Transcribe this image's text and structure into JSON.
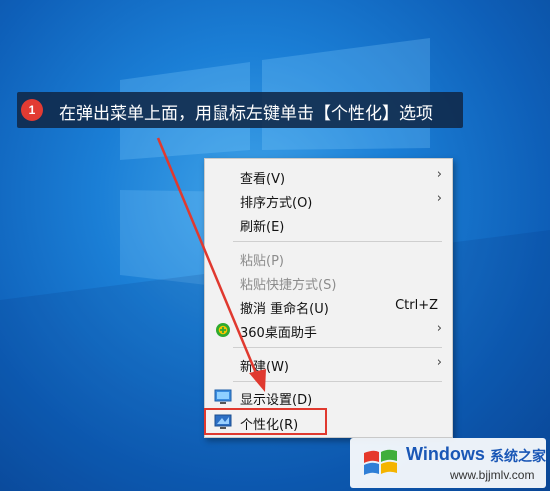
{
  "callout": {
    "step": "1",
    "text": "在弹出菜单上面，用鼠标左键单击【个性化】选项"
  },
  "menu": {
    "items": [
      {
        "label": "查看(V)",
        "submenu": true
      },
      {
        "label": "排序方式(O)",
        "submenu": true
      },
      {
        "label": "刷新(E)"
      },
      {
        "label": "粘贴(P)",
        "disabled": true
      },
      {
        "label": "粘贴快捷方式(S)",
        "disabled": true
      },
      {
        "label": "撤消 重命名(U)",
        "shortcut": "Ctrl+Z"
      },
      {
        "label": "360桌面助手",
        "submenu": true,
        "icon": "360-icon"
      },
      {
        "label": "新建(W)",
        "submenu": true
      },
      {
        "label": "显示设置(D)",
        "icon": "display-icon"
      },
      {
        "label": "个性化(R)",
        "icon": "personalize-icon",
        "highlighted": true
      }
    ],
    "submenu_glyph": "›"
  },
  "watermark": {
    "brand": "Windows",
    "name": "系统之家",
    "url": "www.bjjmlv.com"
  },
  "colors": {
    "highlight_border": "#e0392f",
    "arrow": "#e0392f",
    "callout_badge": "#e23b33",
    "brand": "#1a57b6"
  }
}
